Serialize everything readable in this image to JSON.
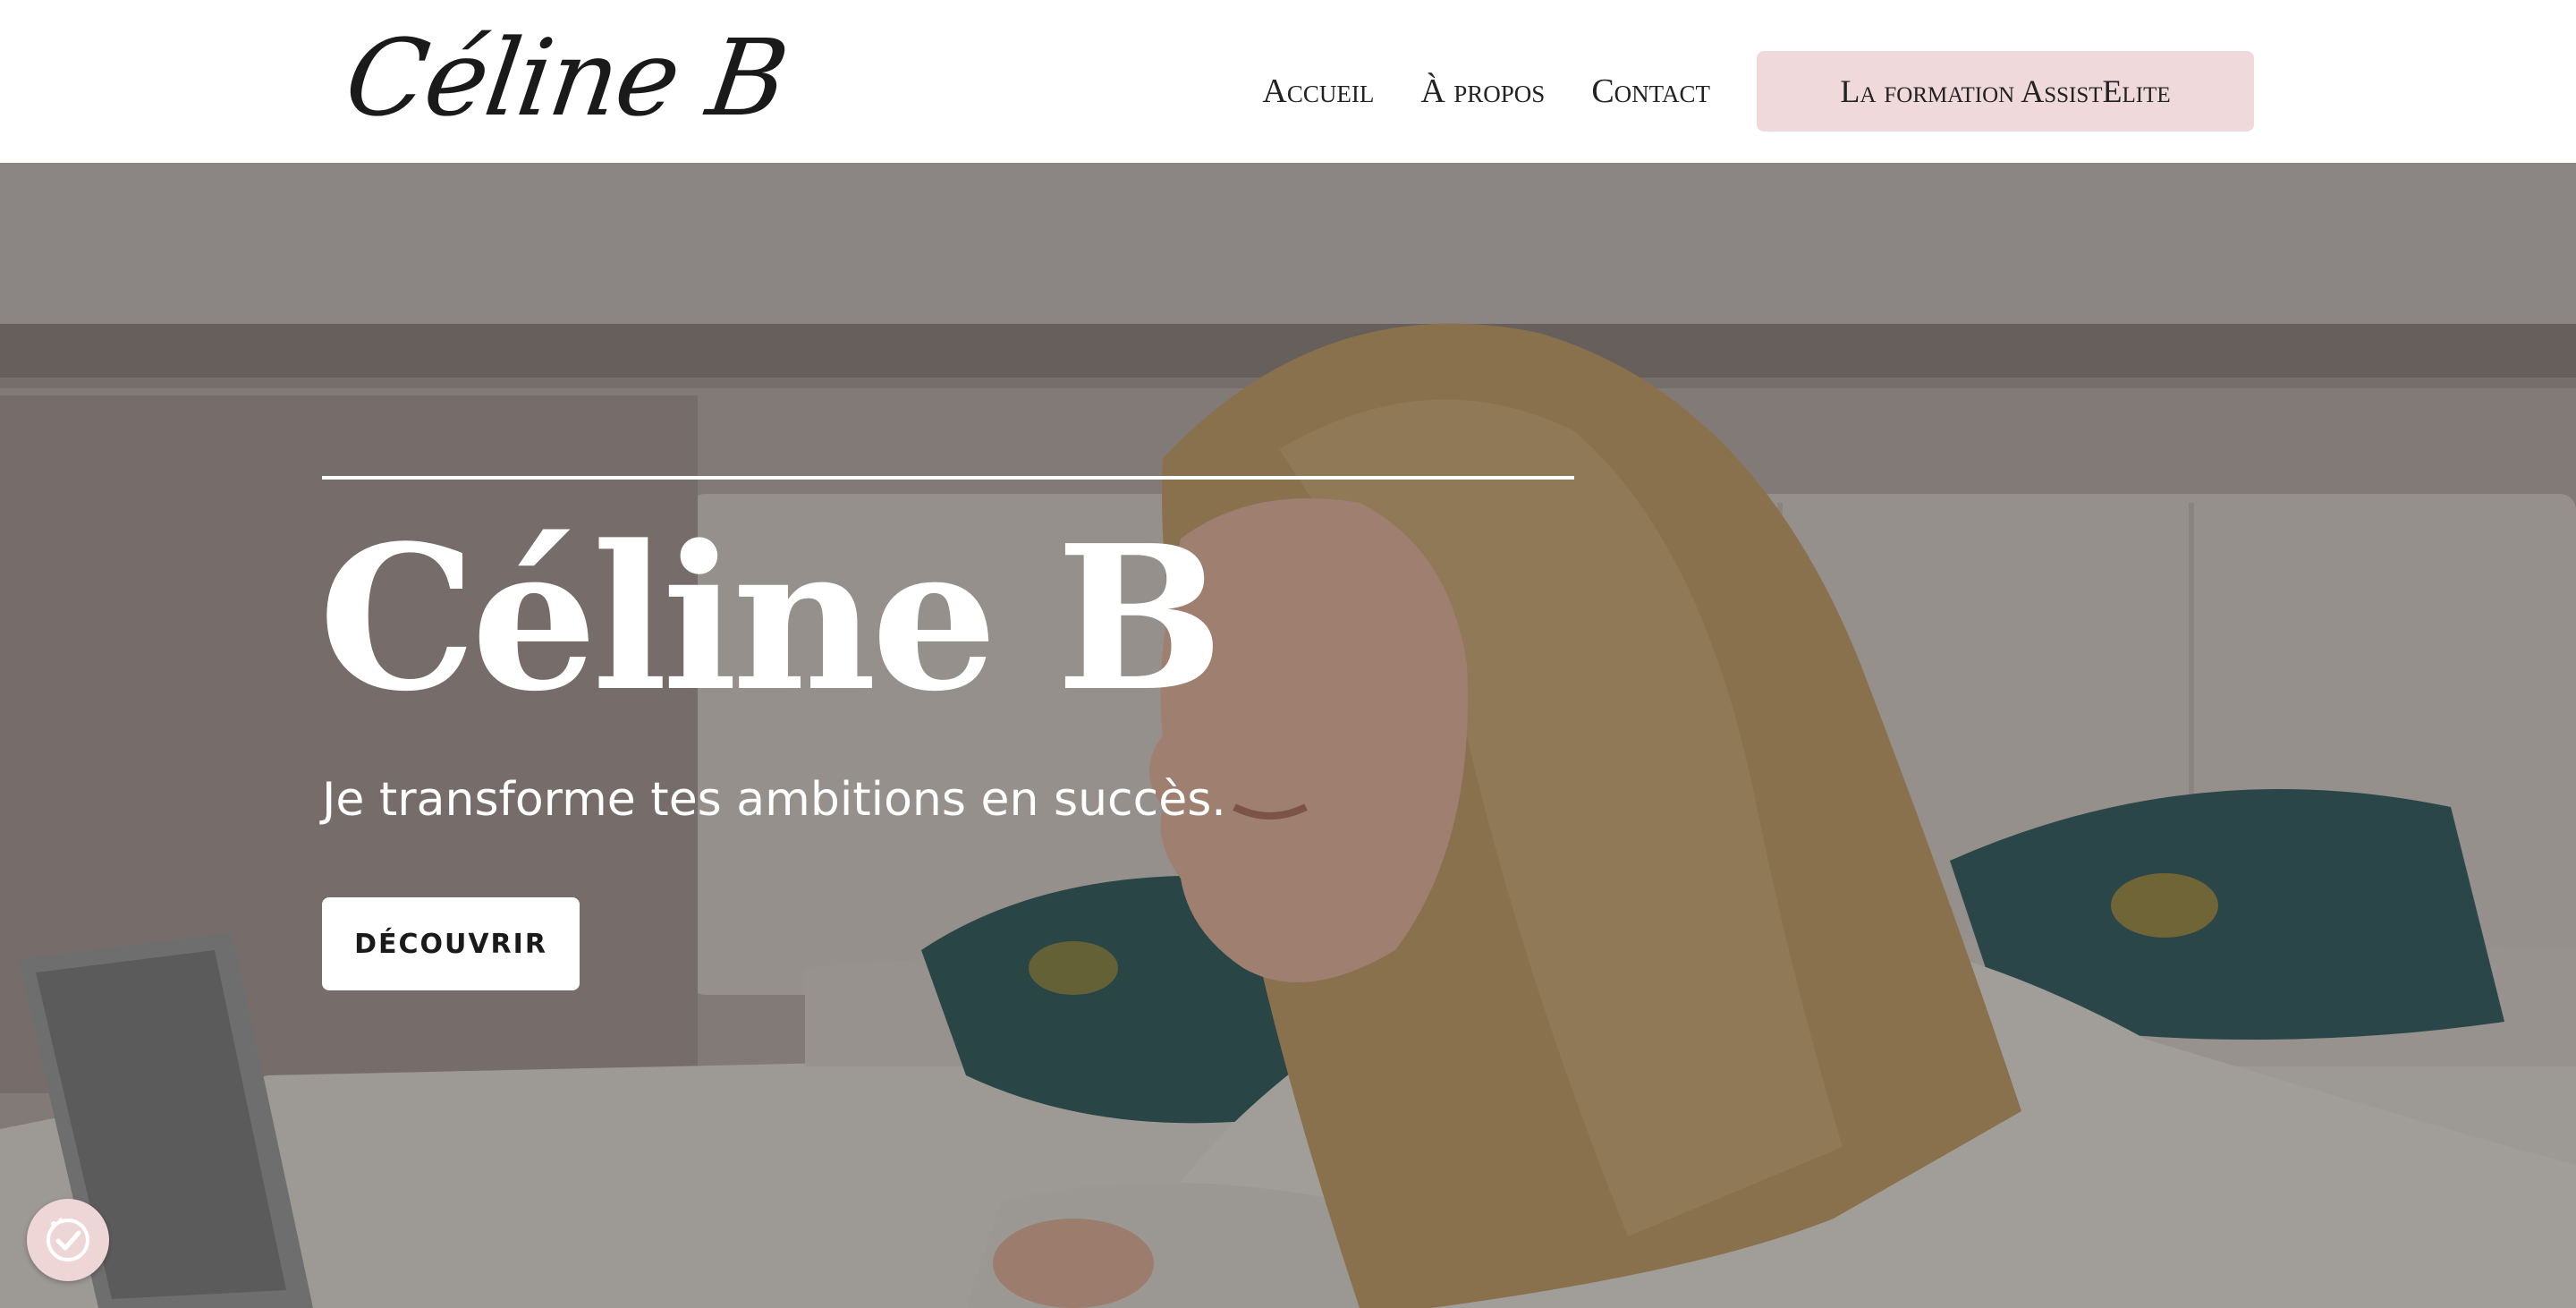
{
  "header": {
    "logo_text": "Céline B",
    "nav": [
      {
        "label": "Accueil"
      },
      {
        "label": "À propos"
      },
      {
        "label": "Contact"
      }
    ],
    "cta_label": "La formation AssistElite",
    "cta_color": "#efd9db"
  },
  "hero": {
    "title": "Céline B",
    "subtitle": "Je transforme tes ambitions en succès.",
    "button_label": "DÉCOUVRIR"
  },
  "widget": {
    "icon": "check-badge-icon"
  }
}
